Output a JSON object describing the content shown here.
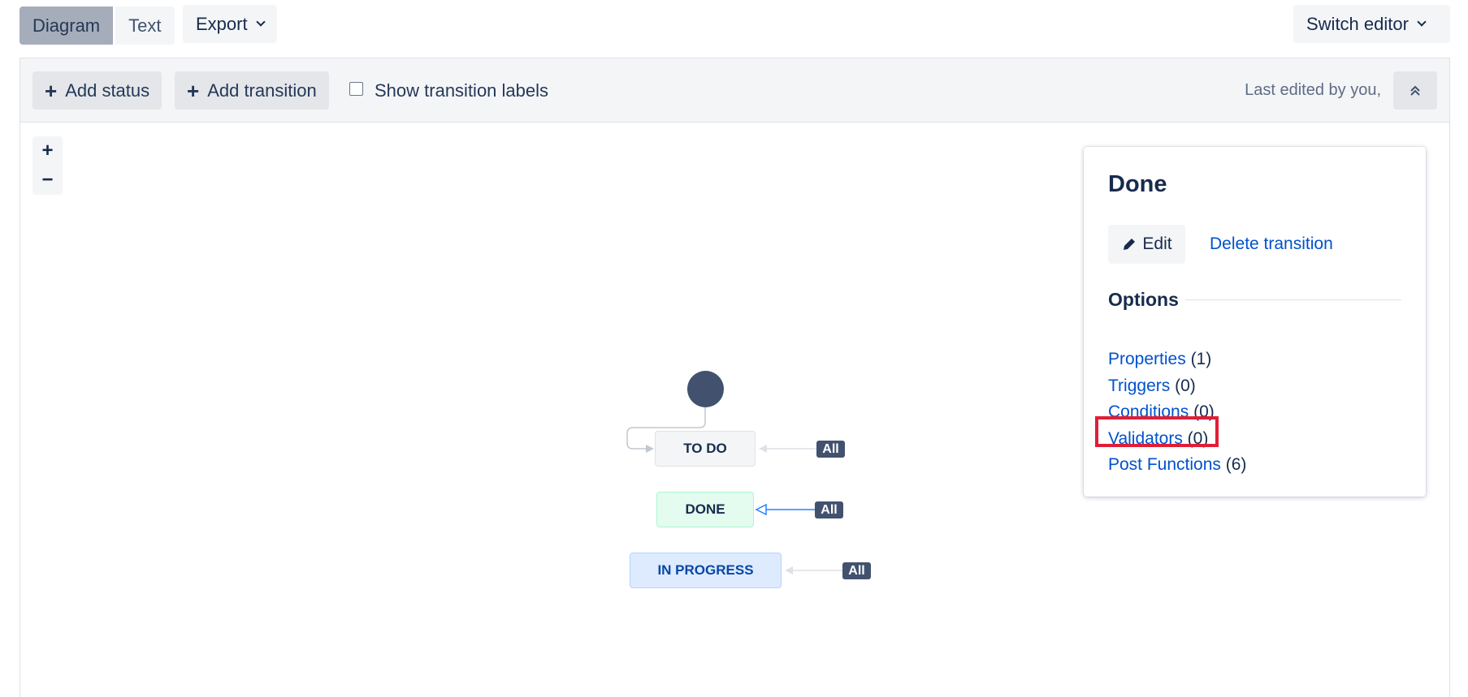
{
  "header": {
    "tabs": [
      {
        "label": "Diagram",
        "active": true
      },
      {
        "label": "Text",
        "active": false
      }
    ],
    "export_label": "Export",
    "switch_editor_label": "Switch editor"
  },
  "toolbar": {
    "add_status_label": "Add status",
    "add_transition_label": "Add transition",
    "show_labels_label": "Show transition labels",
    "show_labels_checked": false,
    "last_edited": "Last edited by you,"
  },
  "zoom": {
    "in": "+",
    "out": "−"
  },
  "diagram": {
    "statuses": [
      {
        "label": "TO DO",
        "category": "todo",
        "color": "#f4f5f7",
        "border": "#dfe1e6",
        "text_color": "#172b4d"
      },
      {
        "label": "DONE",
        "category": "done",
        "color": "#e3fcef",
        "border": "#abf5d1",
        "text_color": "#172b4d"
      },
      {
        "label": "IN PROGRESS",
        "category": "in-progress",
        "color": "#deebff",
        "border": "#b3d4ff",
        "text_color": "#0747a6"
      }
    ],
    "global_transition_label": "All",
    "selected_transition_target": "DONE"
  },
  "panel": {
    "title": "Done",
    "edit_label": "Edit",
    "delete_label": "Delete transition",
    "options_heading": "Options",
    "options": [
      {
        "label": "Properties",
        "count": "(1)"
      },
      {
        "label": "Triggers",
        "count": "(0)"
      },
      {
        "label": "Conditions",
        "count": "(0)"
      },
      {
        "label": "Validators",
        "count": "(0)",
        "highlighted": true
      },
      {
        "label": "Post Functions",
        "count": "(6)"
      }
    ]
  },
  "colors": {
    "link": "#0052cc",
    "highlight": "#e01e37",
    "badge": "#42526e",
    "selected_arrow": "#2684ff"
  }
}
